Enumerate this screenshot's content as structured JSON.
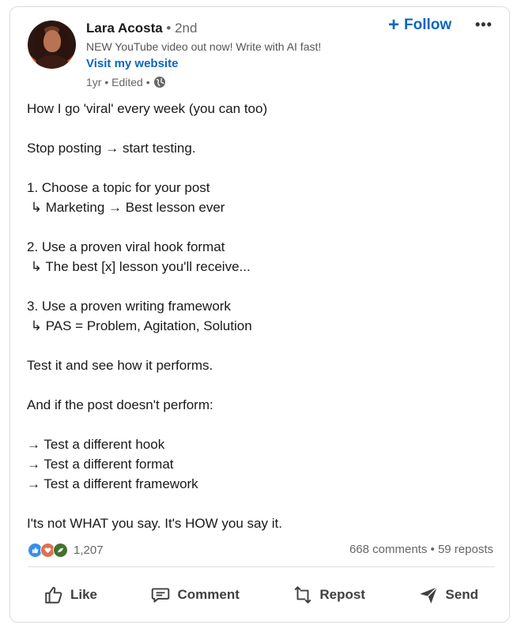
{
  "author": {
    "name": "Lara Acosta",
    "degree": "• 2nd",
    "headline": "NEW YouTube video out now! Write with AI fast!",
    "website": "Visit my website",
    "meta": "1yr • Edited •"
  },
  "header": {
    "follow_label": "Follow",
    "more_label": "•••"
  },
  "post_lines": [
    "How I go 'viral' every week (you can too)",
    "",
    "Stop posting → start testing.",
    "",
    "1. Choose a topic for your post",
    " ↳ Marketing → Best lesson ever",
    "",
    "2. Use a proven viral hook format",
    " ↳ The best [x] lesson you'll receive...",
    "",
    "3. Use a proven writing framework",
    " ↳ PAS = Problem, Agitation, Solution",
    "",
    "Test it and see how it performs.",
    "",
    "And if the post doesn't perform:",
    "",
    "→ Test a different hook",
    "→ Test a different format",
    "→ Test a different framework",
    "",
    "I'ts not WHAT you say. It's HOW you say it."
  ],
  "social": {
    "reaction_count": "1,207",
    "comments": "668 comments",
    "separator": "•",
    "reposts": "59 reposts"
  },
  "actions": {
    "like": "Like",
    "comment": "Comment",
    "repost": "Repost",
    "send": "Send"
  },
  "colors": {
    "accent": "#0a66c2",
    "like": "#378fe9",
    "love": "#df704d",
    "support": "#44712e"
  }
}
